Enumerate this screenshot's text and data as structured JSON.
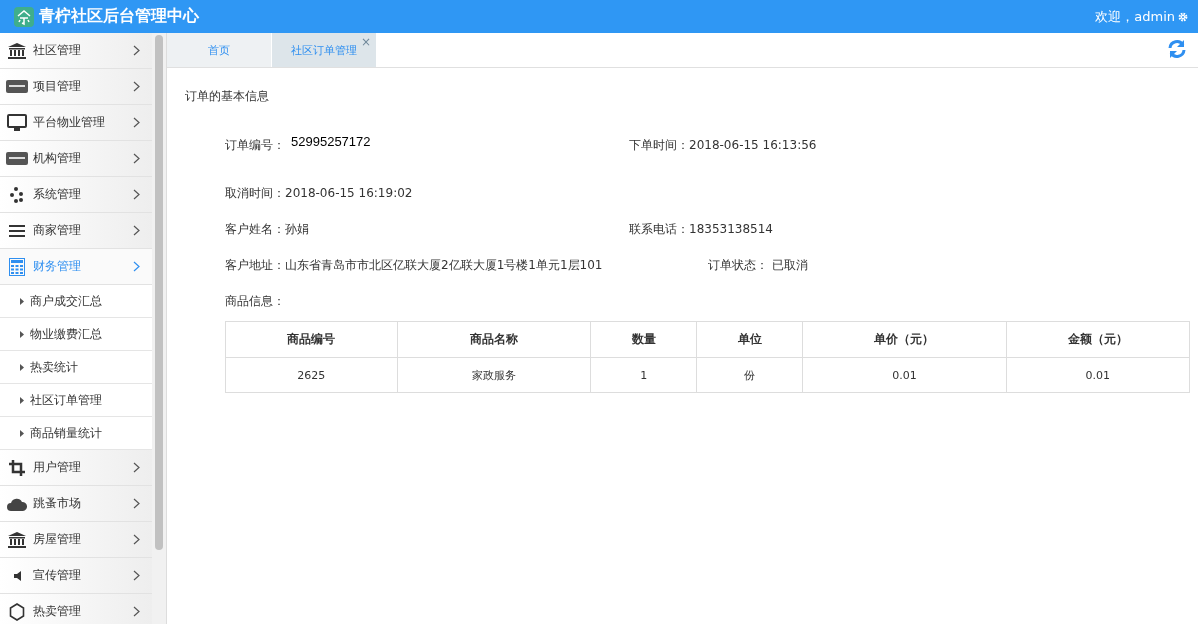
{
  "header": {
    "title": "青柠社区后台管理中心",
    "welcome": "欢迎，admin"
  },
  "sidebar": {
    "items": [
      {
        "label": "社区管理",
        "selected": false
      },
      {
        "label": "项目管理",
        "selected": false
      },
      {
        "label": "平台物业管理",
        "selected": false
      },
      {
        "label": "机构管理",
        "selected": false
      },
      {
        "label": "系统管理",
        "selected": false
      },
      {
        "label": "商家管理",
        "selected": false
      },
      {
        "label": "财务管理",
        "selected": true,
        "expanded": true,
        "children": [
          {
            "label": "商户成交汇总"
          },
          {
            "label": "物业缴费汇总"
          },
          {
            "label": "热卖统计"
          },
          {
            "label": "社区订单管理"
          },
          {
            "label": "商品销量统计"
          }
        ]
      },
      {
        "label": "用户管理",
        "selected": false
      },
      {
        "label": "跳蚤市场",
        "selected": false
      },
      {
        "label": "房屋管理",
        "selected": false
      },
      {
        "label": "宣传管理",
        "selected": false
      },
      {
        "label": "热卖管理",
        "selected": false
      }
    ]
  },
  "tabs": [
    {
      "label": "首页",
      "selected": false
    },
    {
      "label": "社区订单管理",
      "selected": true,
      "close": "×"
    }
  ],
  "section_title": "订单的基本信息",
  "fields": [
    [
      {
        "label": "订单编号：",
        "value": "52995257172"
      },
      {
        "label": "下单时间：",
        "value": "2018-06-15 16:13:56"
      }
    ],
    [
      {
        "label": "取消时间：",
        "value": "2018-06-15 16:19:02"
      }
    ],
    [
      {
        "label": "客户姓名：",
        "value": "孙娟"
      },
      {
        "label": "联系电话：",
        "value": "18353138514"
      }
    ],
    [
      {
        "label": "客户地址：",
        "value": "山东省青岛市市北区亿联大厦2亿联大厦1号楼1单元1层101"
      },
      {
        "label": "订单状态：",
        "value": "已取消"
      }
    ],
    [
      {
        "label": "商品信息："
      }
    ]
  ],
  "table": {
    "columns": [
      "商品编号",
      "商品名称",
      "数量",
      "单位",
      "单价（元）",
      "金额（元）"
    ],
    "rows": [
      [
        "2625",
        "家政服务",
        "1",
        "份",
        "0.01",
        "0.01"
      ]
    ]
  }
}
